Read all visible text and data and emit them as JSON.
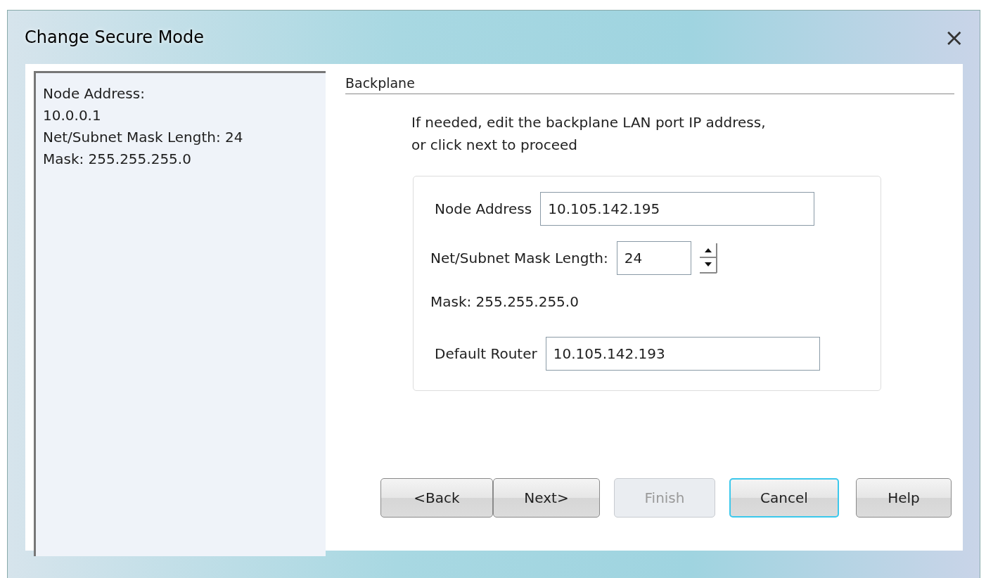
{
  "window": {
    "title": "Change Secure Mode",
    "close": "×"
  },
  "summary": [
    "Node Address:",
    "10.0.0.1",
    "Net/Subnet Mask Length: 24",
    "Mask: 255.255.255.0"
  ],
  "section": {
    "title": "Backplane",
    "instructions": [
      "If needed, edit the backplane LAN port IP address,",
      "or click next to proceed"
    ]
  },
  "form": {
    "node_address": {
      "label": "Node Address",
      "value": "10.105.142.195"
    },
    "mask_length": {
      "label": "Net/Subnet Mask Length:",
      "value": "24"
    },
    "mask": "Mask: 255.255.255.0",
    "default_router": {
      "label": "Default Router",
      "value": "10.105.142.193"
    }
  },
  "buttons": [
    {
      "label": "<Back",
      "disabled": false,
      "focused": false
    },
    {
      "label": "Next>",
      "disabled": false,
      "focused": false
    },
    {
      "label": "Finish",
      "disabled": true,
      "focused": false
    },
    {
      "label": "Cancel",
      "disabled": false,
      "focused": true
    },
    {
      "label": "Help",
      "disabled": false,
      "focused": false
    }
  ]
}
